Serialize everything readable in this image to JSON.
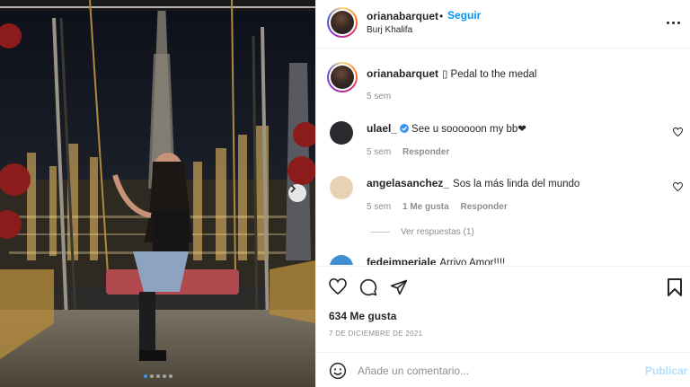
{
  "post": {
    "author": "orianabarquet",
    "follow_dot": "•",
    "follow_label": "Seguir",
    "location": "Burj Khalifa",
    "more_icon": "more-horizontal-icon",
    "photo": {
      "description_icon": "photo-burj-khalifa-swing",
      "slide_count": 5,
      "active_slide": 0,
      "next_icon": "chevron-right-icon"
    }
  },
  "caption": {
    "username": "orianabarquet",
    "text": "▯ Pedal to the medal",
    "time": "5 sem"
  },
  "comments": [
    {
      "username": "ulael_",
      "verified": true,
      "text": "See u soooooon my bb❤",
      "time": "5 sem",
      "likes_label": "",
      "reply_label": "Responder",
      "avatar_color": "#2a2a2e"
    },
    {
      "username": "angelasanchez_",
      "verified": false,
      "text": "Sos la más linda del mundo",
      "time": "5 sem",
      "likes_label": "1 Me gusta",
      "reply_label": "Responder",
      "avatar_color": "#e8d2b6",
      "view_replies": "Ver respuestas (1)"
    },
    {
      "username": "fedeimperiale",
      "verified": false,
      "text": "Arrivo Amor!!!!",
      "avatar_color": "#3d8fd1"
    }
  ],
  "actions": {
    "like_icon": "heart-icon",
    "comment_icon": "comment-icon",
    "share_icon": "paper-plane-icon",
    "save_icon": "bookmark-icon",
    "likes": "634 Me gusta",
    "date": "7 DE DICIEMBRE DE 2021"
  },
  "composer": {
    "emoji_icon": "smiley-icon",
    "placeholder": "Añade un comentario...",
    "post_label": "Publicar"
  },
  "colors": {
    "accent": "#0095f6",
    "post_disabled": "#b2dffc",
    "muted": "#8e8e8e",
    "verified": "#3897f0"
  }
}
